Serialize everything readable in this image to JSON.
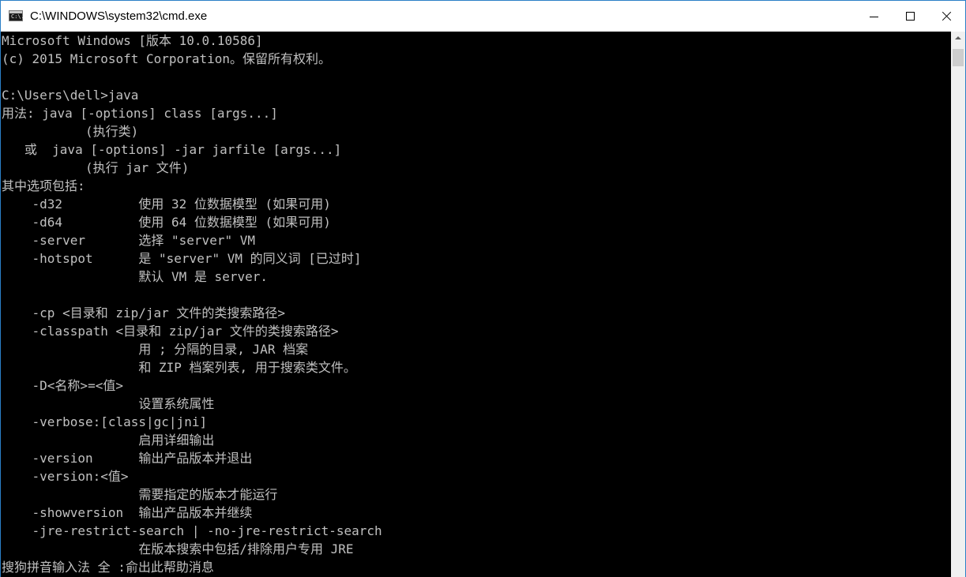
{
  "window": {
    "title": "C:\\WINDOWS\\system32\\cmd.exe",
    "icon": "cmd-icon",
    "icon_glyph": "C:\\.",
    "buttons": [
      "minimize-icon",
      "maximize-icon",
      "close-icon"
    ]
  },
  "console": {
    "text_color": "#c0c0c0",
    "background": "#000000",
    "lines": [
      "Microsoft Windows [版本 10.0.10586]",
      "(c) 2015 Microsoft Corporation。保留所有权利。",
      "",
      "C:\\Users\\dell>java",
      "用法: java [-options] class [args...]",
      "           (执行类)",
      "   或  java [-options] -jar jarfile [args...]",
      "           (执行 jar 文件)",
      "其中选项包括:",
      "    -d32          使用 32 位数据模型 (如果可用)",
      "    -d64          使用 64 位数据模型 (如果可用)",
      "    -server       选择 \"server\" VM",
      "    -hotspot      是 \"server\" VM 的同义词 [已过时]",
      "                  默认 VM 是 server.",
      "",
      "    -cp <目录和 zip/jar 文件的类搜索路径>",
      "    -classpath <目录和 zip/jar 文件的类搜索路径>",
      "                  用 ; 分隔的目录, JAR 档案",
      "                  和 ZIP 档案列表, 用于搜索类文件。",
      "    -D<名称>=<值>",
      "                  设置系统属性",
      "    -verbose:[class|gc|jni]",
      "                  启用详细输出",
      "    -version      输出产品版本并退出",
      "    -version:<值>",
      "                  需要指定的版本才能运行",
      "    -showversion  输出产品版本并继续",
      "    -jre-restrict-search | -no-jre-restrict-search",
      "                  在版本搜索中包括/排除用户专用 JRE",
      "搜狗拼音输入法 全 :俞出此帮助消息"
    ]
  },
  "scrollbar": {
    "up_icon": "scroll-up-arrow-icon"
  }
}
